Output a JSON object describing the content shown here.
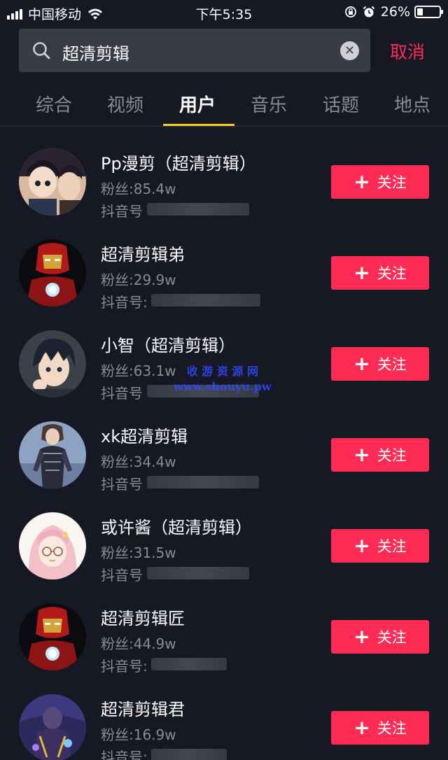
{
  "status_bar": {
    "carrier": "中国移动",
    "time": "下午5:35",
    "battery": "26%"
  },
  "search": {
    "query": "超清剪辑",
    "cancel_label": "取消"
  },
  "tabs": [
    {
      "label": "综合",
      "active": false
    },
    {
      "label": "视频",
      "active": false
    },
    {
      "label": "用户",
      "active": true
    },
    {
      "label": "音乐",
      "active": false
    },
    {
      "label": "话题",
      "active": false
    },
    {
      "label": "地点",
      "active": false
    }
  ],
  "follow_label": "关注",
  "users": [
    {
      "name": "Pp漫剪（超清剪辑）",
      "fans": "粉丝:85.4w",
      "id_prefix": "抖音号",
      "avatar": "anime-couple"
    },
    {
      "name": "超清剪辑弟",
      "fans": "粉丝:29.9w",
      "id_prefix": "抖音号:",
      "avatar": "iron-man"
    },
    {
      "name": "小智（超清剪辑）",
      "fans": "粉丝:63.1w",
      "id_prefix": "抖音号",
      "avatar": "anime-boy"
    },
    {
      "name": "xk超清剪辑",
      "fans": "粉丝:34.4w",
      "id_prefix": "抖音号",
      "avatar": "cyborg-girl"
    },
    {
      "name": "或许酱（超清剪辑）",
      "fans": "粉丝:31.5w",
      "id_prefix": "抖音号",
      "avatar": "pink-anime-girl"
    },
    {
      "name": "超清剪辑匠",
      "fans": "粉丝:44.9w",
      "id_prefix": "抖音号:",
      "avatar": "iron-man"
    },
    {
      "name": "超清剪辑君",
      "fans": "粉丝:16.9w",
      "id_prefix": "抖音号:",
      "avatar": "superhero-villain"
    }
  ],
  "watermark": {
    "line1": "收 游 资 源 网",
    "line2": "www.shouyu.pw"
  },
  "colors": {
    "background": "#161823",
    "accent": "#fe2c55",
    "tab_indicator": "#face15"
  }
}
